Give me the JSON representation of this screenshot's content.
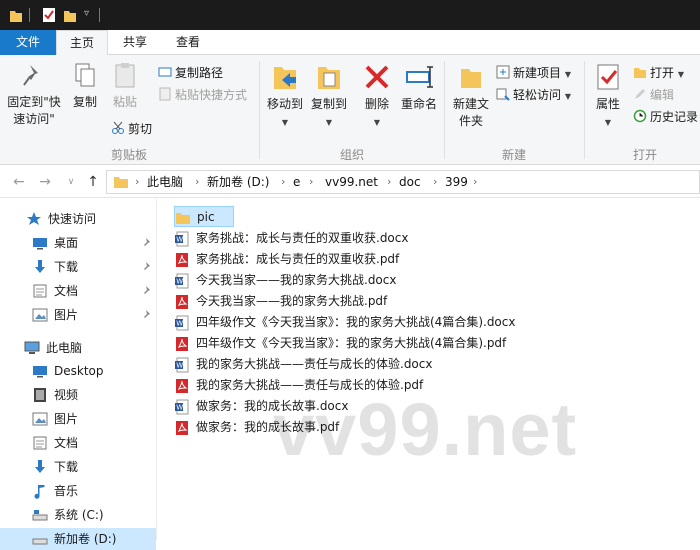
{
  "ribbon_tabs": {
    "file": "文件",
    "home": "主页",
    "share": "共享",
    "view": "查看"
  },
  "ribbon": {
    "pin_quick_access": "固定到\"快速访问\"",
    "copy": "复制",
    "paste": "粘贴",
    "copy_path": "复制路径",
    "paste_shortcut": "粘贴快捷方式",
    "cut": "剪切",
    "clipboard_group": "剪贴板",
    "move_to": "移动到",
    "copy_to": "复制到",
    "delete": "删除",
    "rename": "重命名",
    "organize_group": "组织",
    "new_folder": "新建文件夹",
    "new_item": "新建项目",
    "easy_access": "轻松访问",
    "new_group": "新建",
    "properties": "属性",
    "open": "打开",
    "edit": "编辑",
    "history": "历史记录",
    "open_group": "打开"
  },
  "breadcrumb": [
    "此电脑",
    "新加卷 (D:)",
    "e",
    "vv99.net",
    "doc",
    "399"
  ],
  "nav": {
    "quick_access": "快速访问",
    "qa_items": [
      "桌面",
      "下载",
      "文档",
      "图片"
    ],
    "this_pc": "此电脑",
    "pc_items": [
      "Desktop",
      "视频",
      "图片",
      "文档",
      "下载",
      "音乐",
      "系统 (C:)",
      "新加卷 (D:)"
    ]
  },
  "files": [
    {
      "name": "pic",
      "type": "folder"
    },
    {
      "name": "家务挑战：成长与责任的双重收获.docx",
      "type": "docx"
    },
    {
      "name": "家务挑战：成长与责任的双重收获.pdf",
      "type": "pdf"
    },
    {
      "name": "今天我当家——我的家务大挑战.docx",
      "type": "docx"
    },
    {
      "name": "今天我当家——我的家务大挑战.pdf",
      "type": "pdf"
    },
    {
      "name": "四年级作文《今天我当家》：我的家务大挑战(4篇合集).docx",
      "type": "docx"
    },
    {
      "name": "四年级作文《今天我当家》：我的家务大挑战(4篇合集).pdf",
      "type": "pdf"
    },
    {
      "name": "我的家务大挑战——责任与成长的体验.docx",
      "type": "docx"
    },
    {
      "name": "我的家务大挑战——责任与成长的体验.pdf",
      "type": "pdf"
    },
    {
      "name": "做家务：我的成长故事.docx",
      "type": "docx"
    },
    {
      "name": "做家务：我的成长故事.pdf",
      "type": "pdf"
    }
  ],
  "watermark": "vv99.net",
  "colors": {
    "file_tab": "#1979ca",
    "selection": "#cce8ff",
    "folder": "#f4c55a",
    "pdf": "#d5282b",
    "word": "#2b579a"
  }
}
